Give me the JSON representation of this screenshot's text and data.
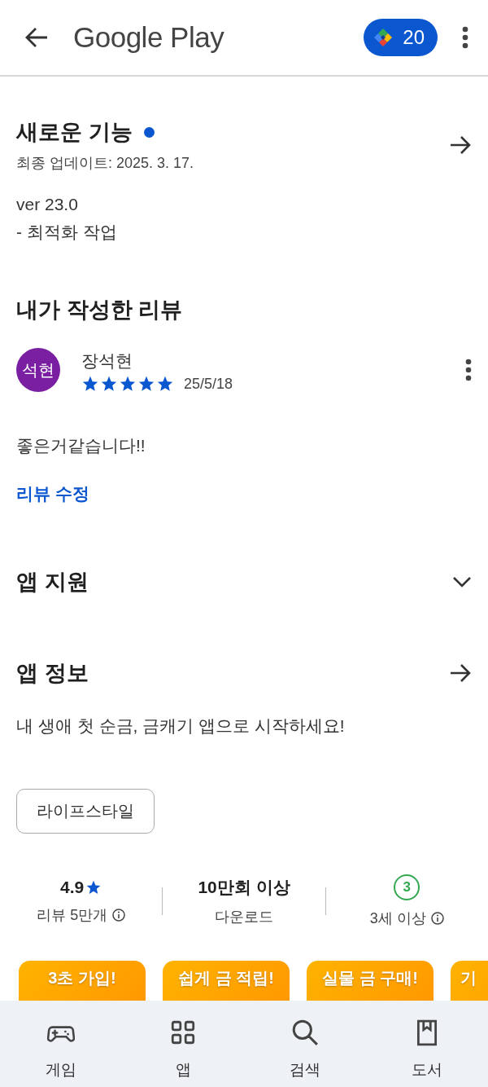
{
  "header": {
    "title": "Google Play",
    "points": "20"
  },
  "whats_new": {
    "title": "새로운 기능",
    "new_dot": true,
    "updated": "최종 업데이트: 2025. 3. 17.",
    "lines": [
      "ver 23.0",
      "- 최적화 작업"
    ]
  },
  "my_review": {
    "title": "내가 작성한 리뷰",
    "avatar": "석현",
    "author": "장석현",
    "stars": 5,
    "date": "25/5/18",
    "text": "좋은거같습니다!!",
    "edit_link": "리뷰 수정"
  },
  "app_support": {
    "title": "앱 지원",
    "expanded": false
  },
  "app_info": {
    "title": "앱 정보",
    "description": "내 생애 첫 순금, 금캐기 앱으로 시작하세요!",
    "category": "라이프스타일"
  },
  "stats": [
    {
      "kind": "rating",
      "value": "4.9",
      "label": "리뷰 5만개"
    },
    {
      "kind": "text",
      "value": "10만회 이상",
      "label": "다운로드"
    },
    {
      "kind": "age",
      "value": "3",
      "label": "3세 이상"
    }
  ],
  "screenshots": [
    {
      "caption": "3초 가입!"
    },
    {
      "caption": "쉽게 금 적립!"
    },
    {
      "caption": "실물 금 구매!"
    },
    {
      "caption": "기"
    }
  ],
  "bottom_nav": [
    {
      "label": "게임",
      "selected": false
    },
    {
      "label": "앱",
      "selected": false
    },
    {
      "label": "검색",
      "selected": false
    },
    {
      "label": "도서",
      "selected": false
    }
  ]
}
